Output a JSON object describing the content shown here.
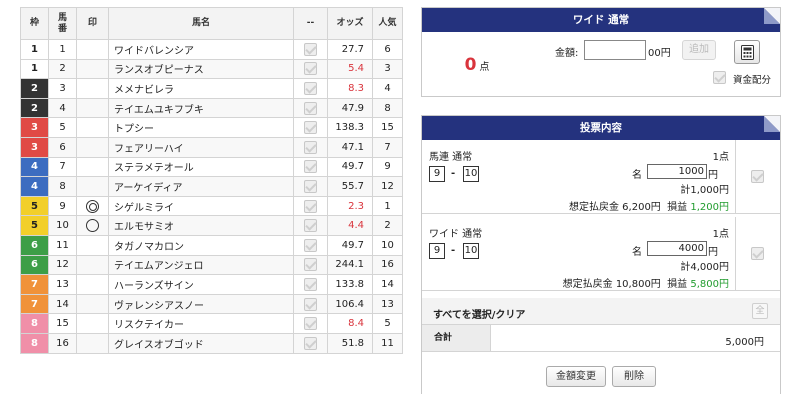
{
  "table": {
    "headers": {
      "waku": "枠",
      "num": "馬\n番",
      "mark": "印",
      "name": "馬名",
      "check": "--",
      "odds": "オッズ",
      "pop": "人気"
    },
    "rows": [
      {
        "waku": "1",
        "num": "1",
        "mark": "",
        "name": "ワイドバレンシア",
        "odds": "27.7",
        "pop": "6",
        "waku_bg": "#ffffff",
        "waku_fg": "#222222",
        "odds_hot": false
      },
      {
        "waku": "1",
        "num": "2",
        "mark": "",
        "name": "ランスオブピーナス",
        "odds": "5.4",
        "pop": "3",
        "waku_bg": "#ffffff",
        "waku_fg": "#222222",
        "odds_hot": true
      },
      {
        "waku": "2",
        "num": "3",
        "mark": "",
        "name": "メメナビレラ",
        "odds": "8.3",
        "pop": "4",
        "waku_bg": "#333333",
        "waku_fg": "#ffffff",
        "odds_hot": true
      },
      {
        "waku": "2",
        "num": "4",
        "mark": "",
        "name": "テイエムユキフブキ",
        "odds": "47.9",
        "pop": "8",
        "waku_bg": "#333333",
        "waku_fg": "#ffffff",
        "odds_hot": false
      },
      {
        "waku": "3",
        "num": "5",
        "mark": "",
        "name": "トプシー",
        "odds": "138.3",
        "pop": "15",
        "waku_bg": "#e04a45",
        "waku_fg": "#ffffff",
        "odds_hot": false
      },
      {
        "waku": "3",
        "num": "6",
        "mark": "",
        "name": "フェアリーハイ",
        "odds": "47.1",
        "pop": "7",
        "waku_bg": "#e04a45",
        "waku_fg": "#ffffff",
        "odds_hot": false
      },
      {
        "waku": "4",
        "num": "7",
        "mark": "",
        "name": "ステラメテオール",
        "odds": "49.7",
        "pop": "9",
        "waku_bg": "#3c6cc0",
        "waku_fg": "#ffffff",
        "odds_hot": false
      },
      {
        "waku": "4",
        "num": "8",
        "mark": "",
        "name": "アーケイディア",
        "odds": "55.7",
        "pop": "12",
        "waku_bg": "#3c6cc0",
        "waku_fg": "#ffffff",
        "odds_hot": false
      },
      {
        "waku": "5",
        "num": "9",
        "mark": "double",
        "name": "シゲルミライ",
        "odds": "2.3",
        "pop": "1",
        "waku_bg": "#f2cf2a",
        "waku_fg": "#222222",
        "odds_hot": true
      },
      {
        "waku": "5",
        "num": "10",
        "mark": "single",
        "name": "エルモサミオ",
        "odds": "4.4",
        "pop": "2",
        "waku_bg": "#f2cf2a",
        "waku_fg": "#222222",
        "odds_hot": true
      },
      {
        "waku": "6",
        "num": "11",
        "mark": "",
        "name": "タガノマカロン",
        "odds": "49.7",
        "pop": "10",
        "waku_bg": "#3d9e47",
        "waku_fg": "#ffffff",
        "odds_hot": false
      },
      {
        "waku": "6",
        "num": "12",
        "mark": "",
        "name": "テイエムアンジェロ",
        "odds": "244.1",
        "pop": "16",
        "waku_bg": "#3d9e47",
        "waku_fg": "#ffffff",
        "odds_hot": false
      },
      {
        "waku": "7",
        "num": "13",
        "mark": "",
        "name": "ハーランズサイン",
        "odds": "133.8",
        "pop": "14",
        "waku_bg": "#f0923a",
        "waku_fg": "#ffffff",
        "odds_hot": false
      },
      {
        "waku": "7",
        "num": "14",
        "mark": "",
        "name": "ヴァレンシアスノー",
        "odds": "106.4",
        "pop": "13",
        "waku_bg": "#f0923a",
        "waku_fg": "#ffffff",
        "odds_hot": false
      },
      {
        "waku": "8",
        "num": "15",
        "mark": "",
        "name": "リスクテイカー",
        "odds": "8.4",
        "pop": "5",
        "waku_bg": "#f08fa8",
        "waku_fg": "#ffffff",
        "odds_hot": true
      },
      {
        "waku": "8",
        "num": "16",
        "mark": "",
        "name": "グレイスオブゴッド",
        "odds": "51.8",
        "pop": "11",
        "waku_bg": "#f08fa8",
        "waku_fg": "#ffffff",
        "odds_hot": false
      }
    ]
  },
  "wide_panel": {
    "title": "ワイド 通常",
    "count": "0",
    "count_unit": "点",
    "amount_label": "金額:",
    "amount_value": "",
    "amount_unit": "00円",
    "add_label": "追加",
    "calc_icon": "calculator-icon",
    "fund_label": "資金配分"
  },
  "vote_panel": {
    "title": "投票内容",
    "bets": [
      {
        "type": "馬連 通常",
        "points": "1点",
        "horse_a": "9",
        "horse_b": "10",
        "mei": "名",
        "amount": "1000",
        "yen": "円",
        "total": "計1,000円",
        "payout_label": "想定払戻金 6,200円",
        "profit_label": "損益",
        "profit": "1,200円"
      },
      {
        "type": "ワイド 通常",
        "points": "1点",
        "horse_a": "9",
        "horse_b": "10",
        "mei": "名",
        "amount": "4000",
        "yen": "円",
        "total": "計4,000円",
        "payout_label": "想定払戻金 10,800円",
        "profit_label": "損益",
        "profit": "5,800円"
      }
    ],
    "select_all_label": "すべてを選択/クリア",
    "select_all_btn": "全",
    "total_label": "合計",
    "total_value": "5,000円"
  },
  "actions": {
    "change_label": "金額変更",
    "delete_label": "削除"
  },
  "colors": {
    "header_navy": "#24327e",
    "odds_hot": "#d9343c",
    "profit_green": "#219c2e"
  }
}
